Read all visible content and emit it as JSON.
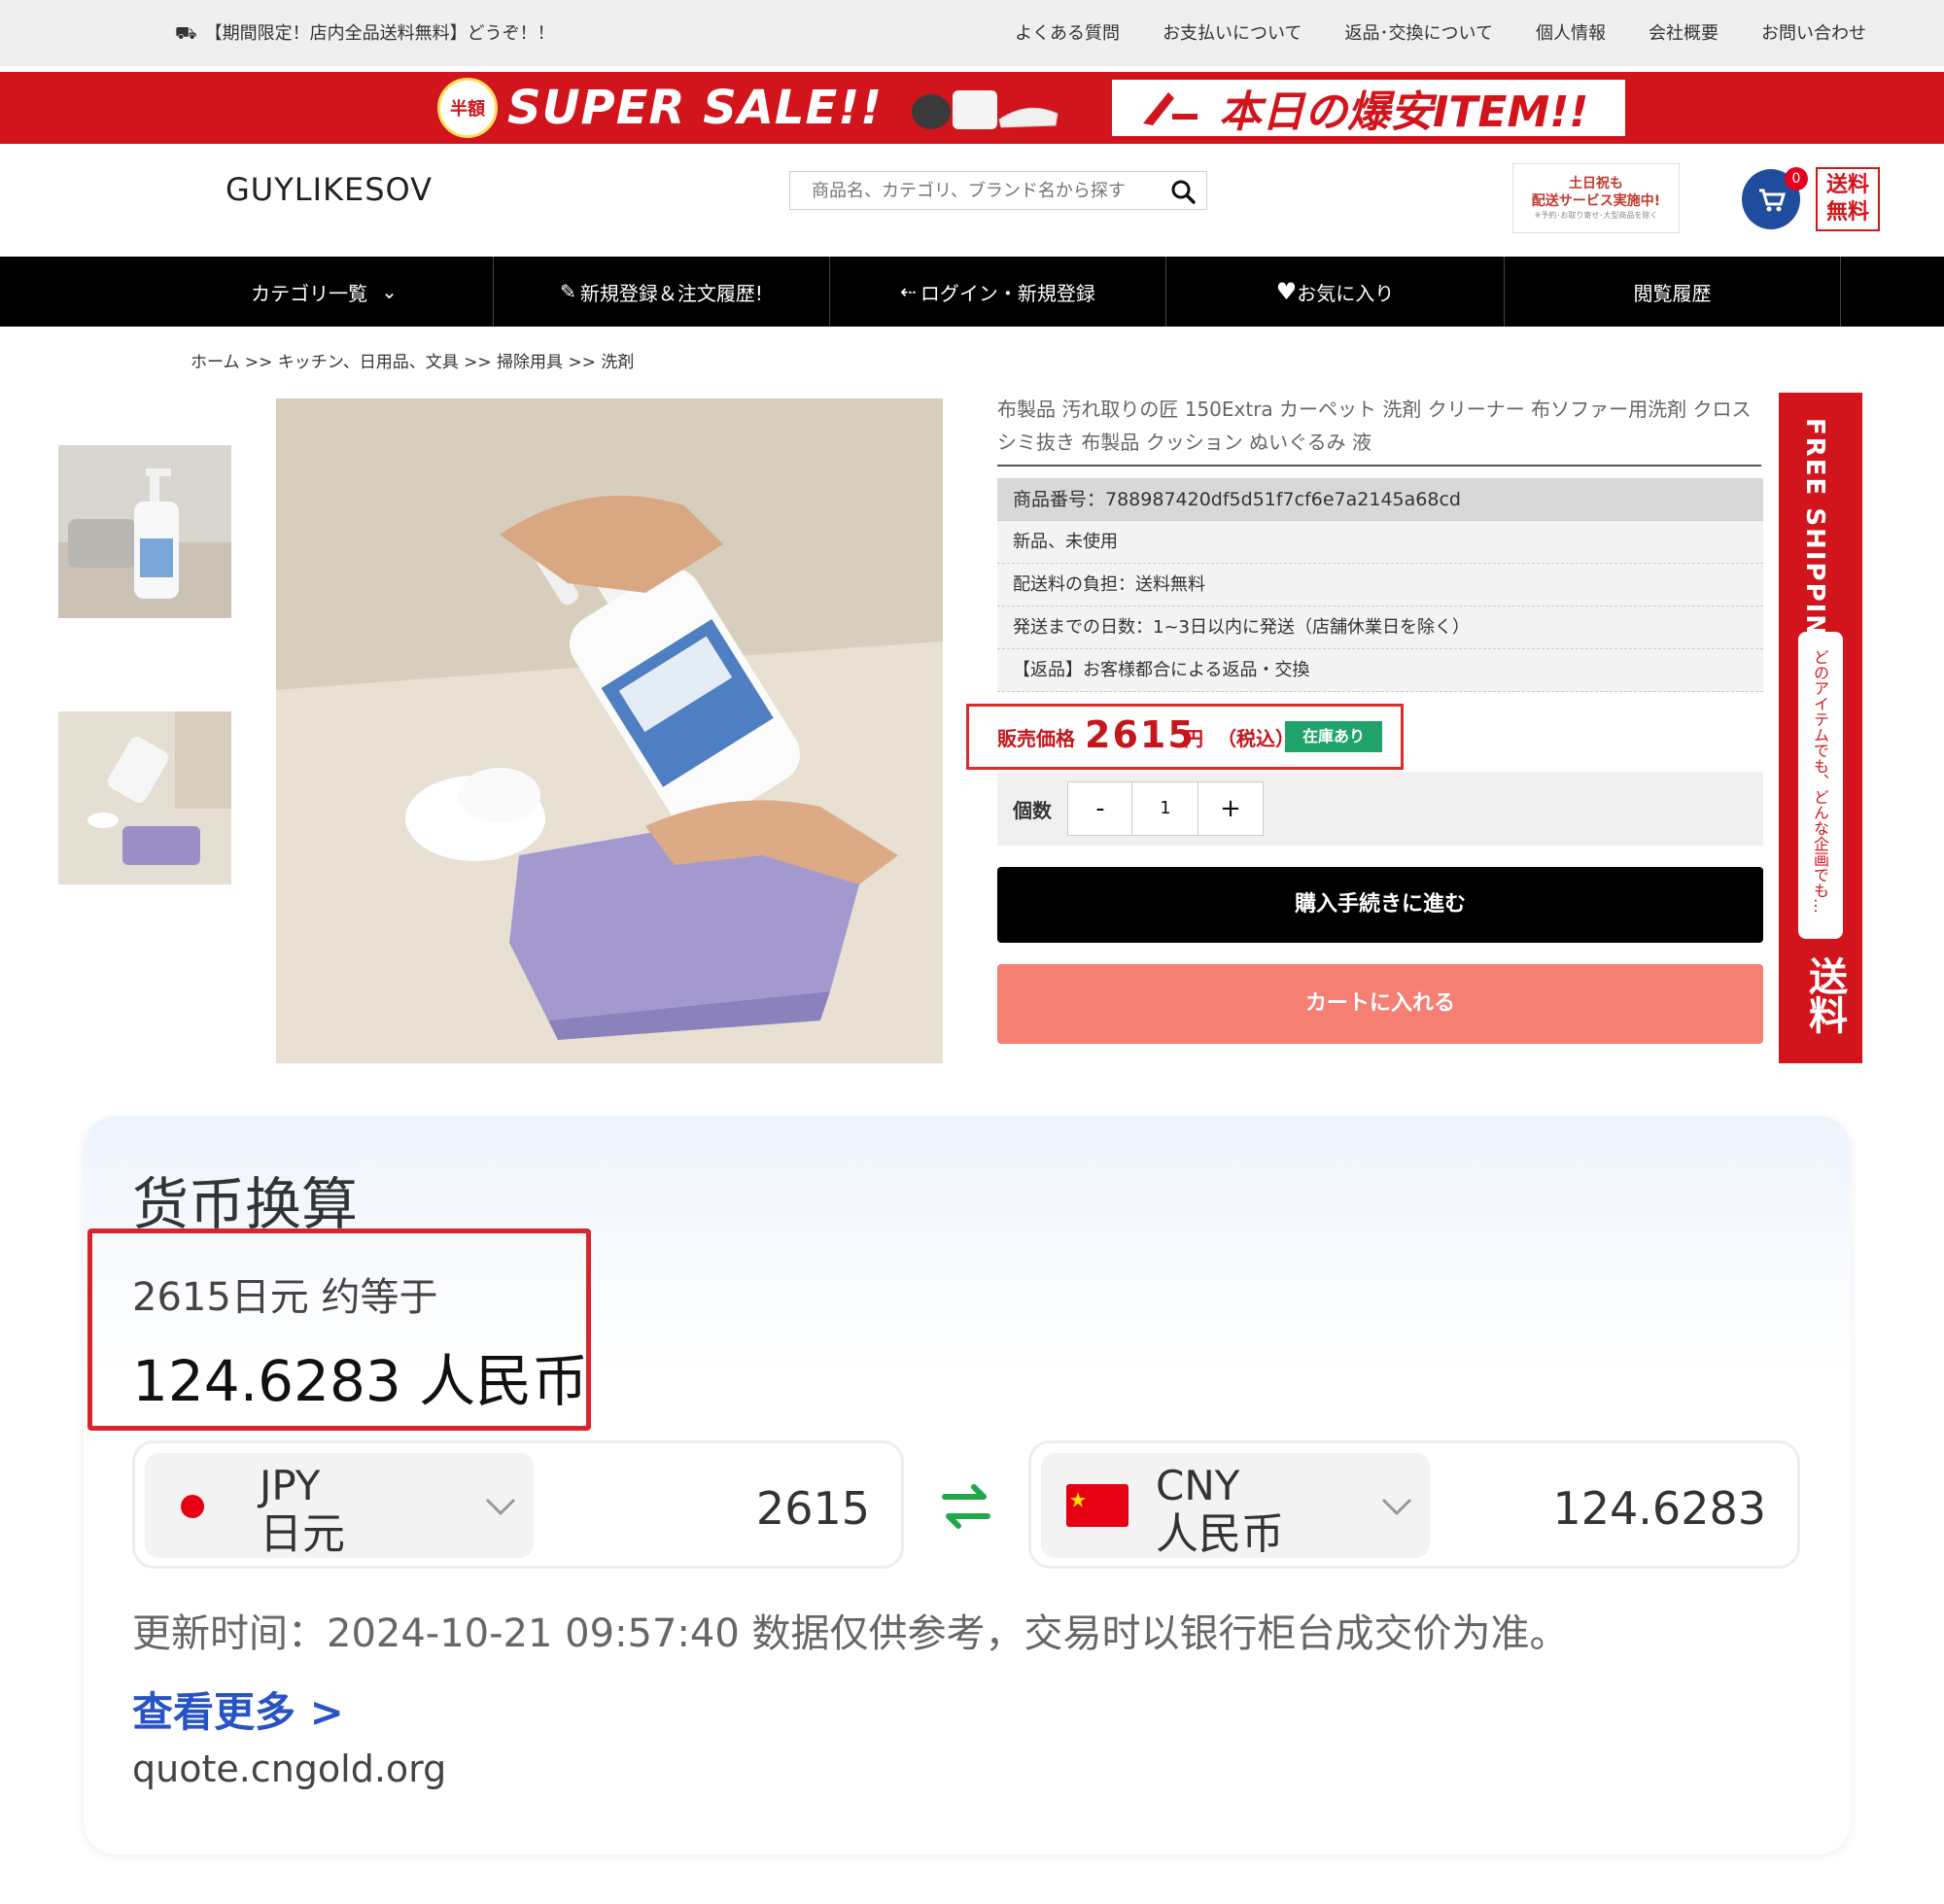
{
  "topbar": {
    "promo": "【期間限定！店内全品送料無料】どうぞ！！",
    "links": [
      "よくある質問",
      "お支払いについて",
      "返品･交換について",
      "個人情報",
      "会社概要",
      "お問い合わせ"
    ]
  },
  "banner": {
    "badge": "半額",
    "left_text": "SUPER SALE!!",
    "right_text": "本日の爆安ITEM!!"
  },
  "header": {
    "logo": "GUYLIKESOV",
    "search_placeholder": "商品名、カテゴリ、ブランド名から探す",
    "weekend_line1": "土日祝も",
    "weekend_line2": "配送サービス実施中!",
    "weekend_line3": "※予約･お取り寄せ･大型商品を除く",
    "cart_count": "0",
    "free_shipping": "送料無料"
  },
  "nav": [
    "カテゴリ一覧",
    "新規登録＆注文履歴!",
    "ログイン・新規登録",
    "お気に入り",
    "閲覧履歴"
  ],
  "breadcrumb": "ホーム >> キッチン、日用品、文具 >> 掃除用具 >> 洗剤",
  "product": {
    "title": "布製品 汚れ取りの匠 150Extra カーペット 洗剤 クリーナー 布ソファー用洗剤 クロス シミ抜き 布製品 クッション ぬいぐるみ 液",
    "specs": [
      "商品番号：788987420df5d51f7cf6e7a2145a68cd",
      "新品、未使用",
      "配送料の負担：送料無料",
      "発送までの日数：1~3日以内に発送（店舗休業日を除く）",
      "【返品】お客様都合による返品・交換"
    ],
    "price_label": "販売価格",
    "price": "2615",
    "price_unit": "円",
    "price_tax": "（税込）",
    "stock": "在庫あり",
    "qty_label": "個数",
    "qty_minus": "-",
    "qty_value": "1",
    "qty_plus": "+",
    "buy_button": "購入手続きに進む",
    "cart_button": "カートに入れる"
  },
  "side_banner": {
    "free_shipping": "FREE SHIPPING",
    "middle": "どのアイテムでも、どんな企画でも…",
    "bottom": "送料"
  },
  "converter": {
    "title": "货币换算",
    "line1": "2615日元 约等于",
    "line2": "124.6283 人民币",
    "from": {
      "code": "JPY",
      "name": "日元",
      "amount": "2615"
    },
    "to": {
      "code": "CNY",
      "name": "人民币",
      "amount": "124.6283"
    },
    "update": "更新时间：2024-10-21 09:57:40 数据仅供参考，交易时以银行柜台成交价为准。",
    "more": "查看更多 >",
    "source": "quote.cngold.org"
  },
  "colors": {
    "sale_red": "#d2151c",
    "stock_green": "#1fa36a",
    "cart_button": "#f57f72",
    "link_blue": "#2754c5"
  }
}
